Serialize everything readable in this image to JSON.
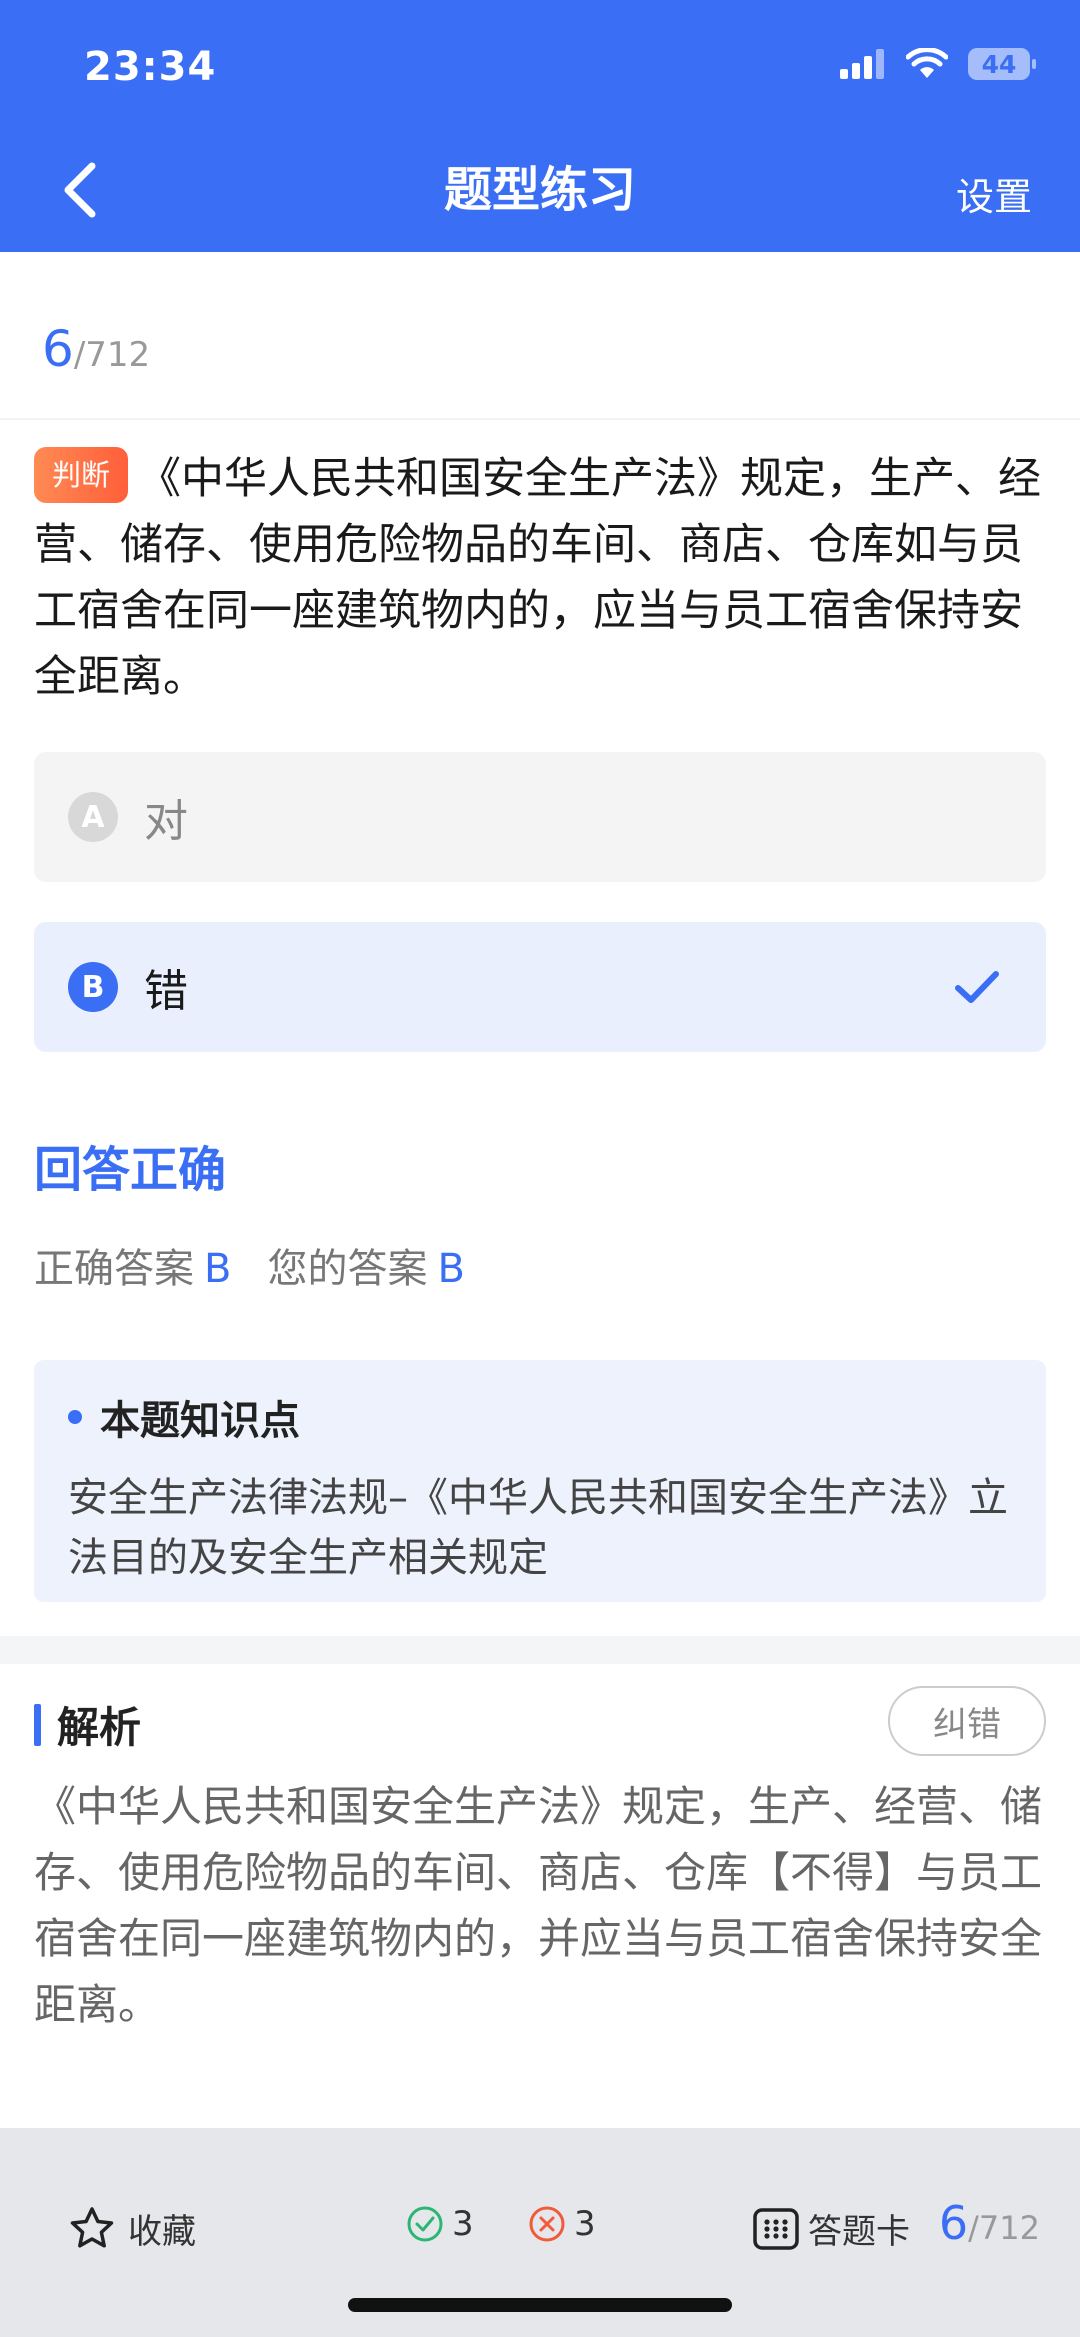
{
  "status_bar": {
    "time": "23:34",
    "battery": "44"
  },
  "nav": {
    "title": "题型练习",
    "settings_label": "设置"
  },
  "progress": {
    "current": "6",
    "total": "/712"
  },
  "question": {
    "type_tag": "判断",
    "text": "《中华人民共和国安全生产法》规定，生产、经营、储存、使用危险物品的车间、商店、仓库如与员工宿舍在同一座建筑物内的，应当与员工宿舍保持安全距离。"
  },
  "options": [
    {
      "letter": "A",
      "text": "对",
      "selected": false
    },
    {
      "letter": "B",
      "text": "错",
      "selected": true
    }
  ],
  "result": {
    "status": "回答正确",
    "correct_label": "正确答案",
    "correct_value": "B",
    "your_label": "您的答案",
    "your_value": "B"
  },
  "knowledge": {
    "title": "本题知识点",
    "body": "安全生产法律法规–《中华人民共和国安全生产法》立法目的及安全生产相关规定"
  },
  "analysis": {
    "title": "解析",
    "report_label": "纠错",
    "body": "《中华人民共和国安全生产法》规定，生产、经营、储存、使用危险物品的车间、商店、仓库【不得】与员工宿舍在同一座建筑物内的，并应当与员工宿舍保持安全距离。"
  },
  "bottom_bar": {
    "favorite_label": "收藏",
    "right_count": "3",
    "wrong_count": "3",
    "answer_card_label": "答题卡",
    "progress_current": "6",
    "progress_total": "/712"
  },
  "colors": {
    "primary": "#3a6ef5",
    "tag": "#ff6a3d",
    "right": "#2bb673",
    "wrong": "#f25a3c"
  },
  "icons": [
    "back-chevron-icon",
    "signal-icon",
    "wifi-icon",
    "battery-icon",
    "check-icon",
    "star-icon",
    "right-circle-icon",
    "wrong-circle-icon",
    "grid-icon"
  ]
}
